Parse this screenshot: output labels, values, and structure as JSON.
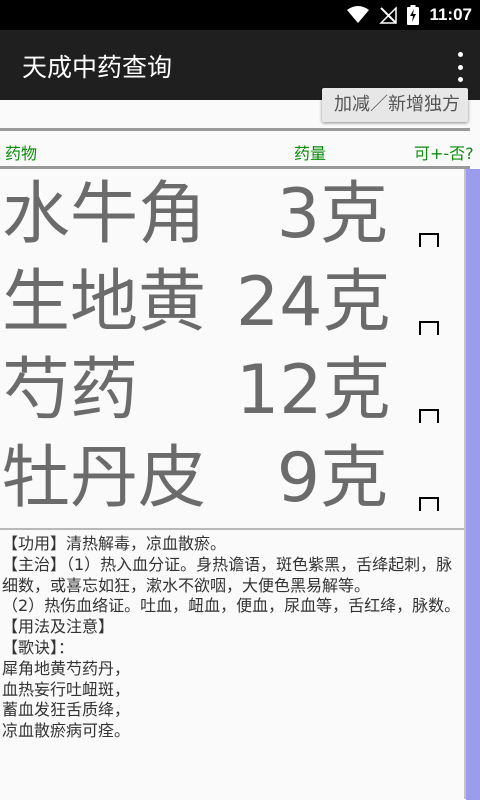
{
  "status_bar": {
    "time": "11:07",
    "icons": [
      "wifi-icon",
      "no-signal-icon",
      "battery-charging-icon"
    ]
  },
  "app_bar": {
    "title": "天成中药查询",
    "menu_icon": "more-vert-icon"
  },
  "add_button": {
    "label": "加减／新增独方"
  },
  "table_header": {
    "herb": "药物",
    "dose": "药量",
    "toggle": "可+-否?"
  },
  "herbs": [
    {
      "name": "水牛角",
      "dose": "3克",
      "checked": false
    },
    {
      "name": "生地黄",
      "dose": "24克",
      "checked": false
    },
    {
      "name": "芍药",
      "dose": "12克",
      "checked": false
    },
    {
      "name": "牡丹皮",
      "dose": "9克",
      "checked": false
    }
  ],
  "info": {
    "lines": [
      "【功用】清热解毒，凉血散瘀。",
      "【主治】（1）热入血分证。身热谵语，斑色紫黑，舌绛起刺，脉细数，或喜忘如狂，漱水不欲咽，大便色黑易解等。",
      "（2）热伤血络证。吐血，衄血，便血，尿血等，舌红绛，脉数。",
      "【用法及注意】",
      "【歌诀】：",
      "犀角地黄芍药丹，",
      "血热妄行吐衄斑，",
      "蓄血发狂舌质绛，",
      "凉血散瘀病可痊。"
    ]
  },
  "colors": {
    "header_green": "#0b8a0b",
    "app_bar": "#1f1f1f",
    "scroll_thumb": "#9c9cec"
  }
}
